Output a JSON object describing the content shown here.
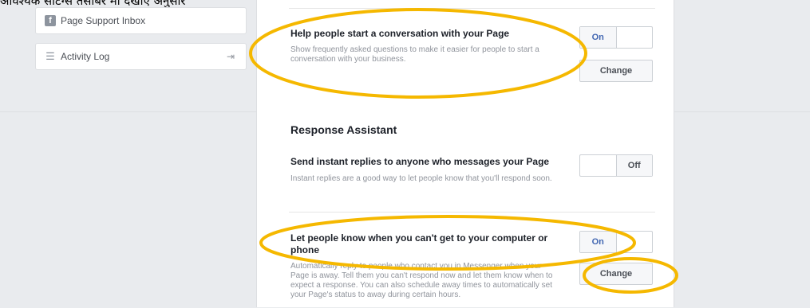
{
  "caption": "आवश्यक  सेटिंग्स  तसबिर  मा  देखाए  अनुसार",
  "sidebar": {
    "support_inbox": {
      "icon": "facebook-icon",
      "label": "Page Support Inbox"
    },
    "activity_log": {
      "icon": "list-icon",
      "label": "Activity Log",
      "trailing_icon": "exit-icon"
    }
  },
  "conversation": {
    "title": "Help people start a conversation with your Page",
    "description": "Show frequently asked questions to make it easier for people to start a conversation with your business.",
    "toggle": {
      "on_label": "On",
      "off_label": "",
      "state": "on"
    },
    "change_label": "Change"
  },
  "response_assistant": {
    "heading": "Response Assistant",
    "instant": {
      "title": "Send instant replies to anyone who messages your Page",
      "description": "Instant replies are a good way to let people know that you'll respond soon.",
      "toggle": {
        "on_label": "",
        "off_label": "Off",
        "state": "off"
      }
    },
    "away": {
      "title": "Let people know when you can't get to your computer or phone",
      "description": "Automatically reply to people who contact you in Messenger when your Page is away. Tell them you can't respond now and let them know when to expect a response. You can also schedule away times to automatically set your Page's status to away during certain hours.",
      "toggle": {
        "on_label": "On",
        "off_label": "",
        "state": "on"
      },
      "change_label": "Change"
    }
  },
  "colors": {
    "annotation": "#f5b800",
    "accent": "#4267b2",
    "background": "#e9ebee"
  }
}
